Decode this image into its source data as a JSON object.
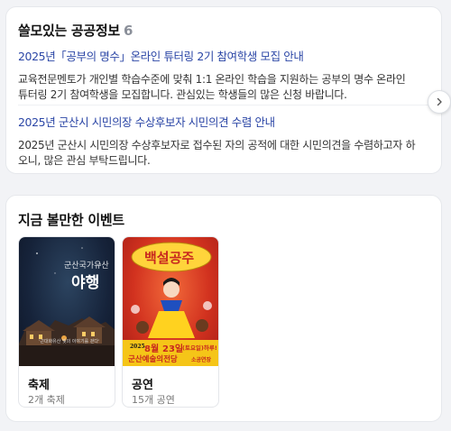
{
  "info": {
    "title": "쓸모있는 공공정보",
    "count": "6",
    "items": [
      {
        "link": "2025년「공부의 명수」온라인 튜터링 2기 참여학생 모집 안내",
        "desc": "교육전문멘토가 개인별 학습수준에 맞춰 1:1 온라인 학습을 지원하는 공부의 명수 온라인 튜터링 2기 참여학생을 모집합니다. 관심있는 학생들의 많은 신청 바랍니다."
      },
      {
        "link": "2025년 군산시 시민의장 수상후보자 시민의견 수렴 안내",
        "desc": "2025년 군산시 시민의장 수상후보자로 접수된 자의 공적에 대한 시민의견을 수렴하고자 하오니, 많은 관심 부탁드립니다."
      }
    ],
    "next_icon": "chevron-right-icon"
  },
  "events": {
    "title": "지금 볼만한 이벤트",
    "items": [
      {
        "name": "축제",
        "sub": "2개 축제",
        "poster": {
          "small_text": "군산국가유산",
          "big_text": "야행",
          "footer_text": "'근대화유산 빛의 이야기를 걷다'"
        }
      },
      {
        "name": "공연",
        "sub": "15개 공연",
        "poster": {
          "title_text": "백설공주",
          "date_month": "8월",
          "date_day": "23일",
          "date_note": "(토요일)하루!",
          "year": "2025.",
          "venue": "군산예술의전당",
          "hall": "소공연장"
        }
      }
    ]
  },
  "colors": {
    "link": "#2b46a6",
    "count": "#8a8f99",
    "poster1_bg": "#1a2a3e",
    "poster2_bg": "#c8281f"
  }
}
